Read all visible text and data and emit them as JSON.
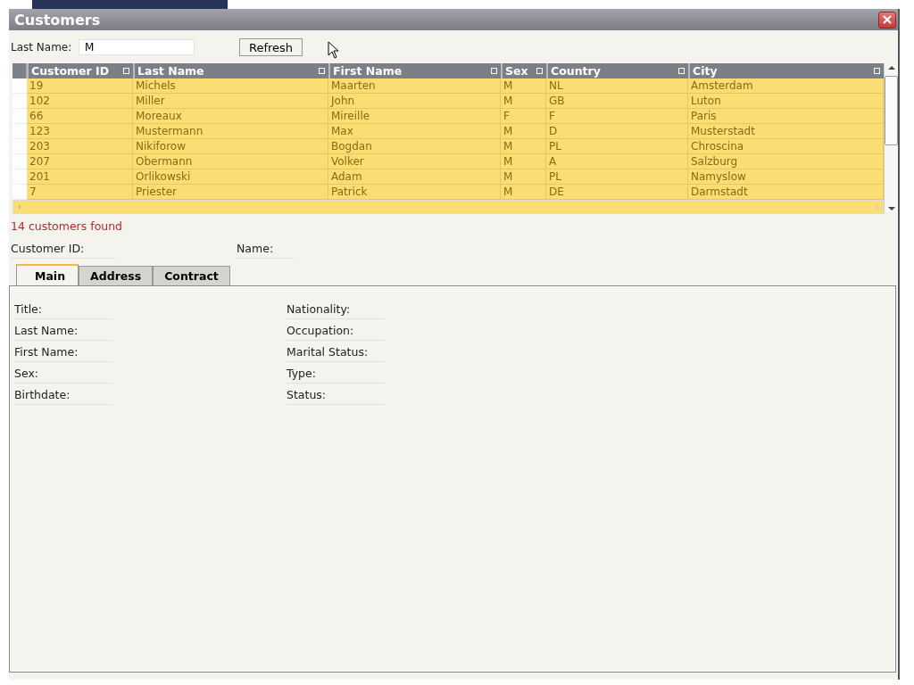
{
  "window": {
    "title": "Customers"
  },
  "search": {
    "label": "Last Name:",
    "value": "M",
    "button": "Refresh"
  },
  "table": {
    "columns": [
      "Customer ID",
      "Last Name",
      "First Name",
      "Sex",
      "Country",
      "City"
    ],
    "rows": [
      [
        "19",
        "Michels",
        "Maarten",
        "M",
        "NL",
        "Amsterdam"
      ],
      [
        "102",
        "Miller",
        "John",
        "M",
        "GB",
        "Luton"
      ],
      [
        "66",
        "Moreaux",
        "Mireille",
        "F",
        "F",
        "Paris"
      ],
      [
        "123",
        "Mustermann",
        "Max",
        "M",
        "D",
        "Musterstadt"
      ],
      [
        "203",
        "Nikiforow",
        "Bogdan",
        "M",
        "PL",
        "Chroscina"
      ],
      [
        "207",
        "Obermann",
        "Volker",
        "M",
        "A",
        "Salzburg"
      ],
      [
        "201",
        "Orlikowski",
        "Adam",
        "M",
        "PL",
        "Namyslow"
      ],
      [
        "7",
        "Priester",
        "Patrick",
        "M",
        "DE",
        "Darmstadt"
      ]
    ]
  },
  "result_message": "14 customers found",
  "header_fields": [
    "Customer ID:",
    "Name:"
  ],
  "tabs": [
    {
      "label": "Main",
      "selected": true
    },
    {
      "label": "Address",
      "selected": false
    },
    {
      "label": "Contract",
      "selected": false
    }
  ],
  "main_fields": {
    "left": [
      "Title:",
      "Last Name:",
      "First Name:",
      "Sex:",
      "Birthdate:"
    ],
    "right": [
      "Nationality:",
      "Occupation:",
      "Marital Status:",
      "Type:",
      "Status:"
    ]
  }
}
